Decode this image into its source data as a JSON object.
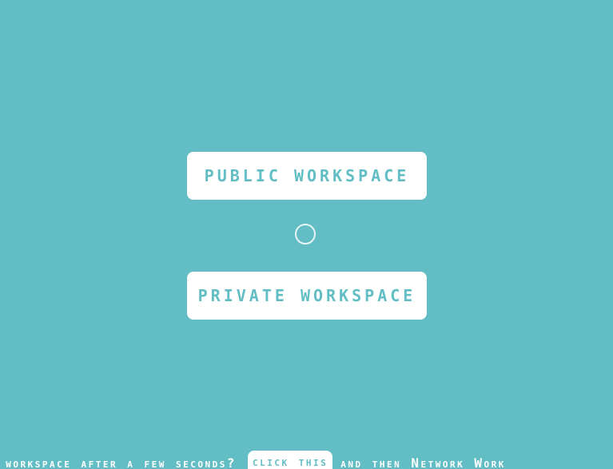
{
  "buttons": {
    "public_label": "public workspace",
    "private_label": "private workspace"
  },
  "footer": {
    "prefix": "n workspace after a few seconds?",
    "link_label": "click this",
    "suffix": "and then Network Work"
  },
  "colors": {
    "background": "#62bec4",
    "button_bg": "#ffffff",
    "button_text": "#62bec4"
  },
  "icons": {
    "loading": "loading-spinner-icon"
  }
}
